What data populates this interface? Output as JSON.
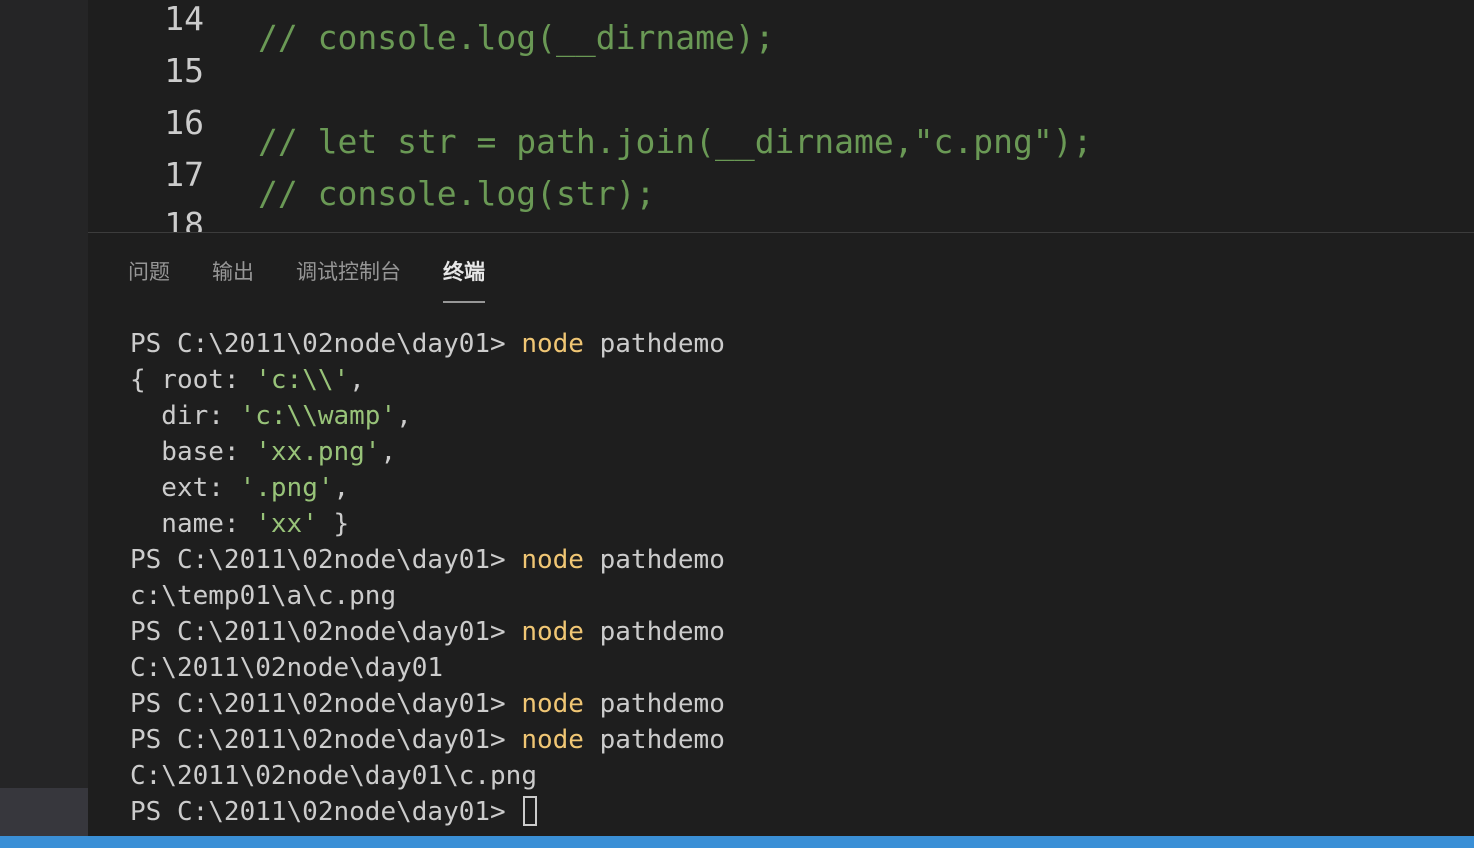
{
  "editor": {
    "lines": [
      {
        "num": "14",
        "code": "// console.log(__dirname);"
      },
      {
        "num": "15",
        "code": ""
      },
      {
        "num": "16",
        "code": "// let str = path.join(__dirname,\"c.png\");"
      },
      {
        "num": "17",
        "code": "// console.log(str);"
      },
      {
        "num": "18",
        "code": ""
      }
    ]
  },
  "panel": {
    "tabs": [
      {
        "label": "问题",
        "active": false
      },
      {
        "label": "输出",
        "active": false
      },
      {
        "label": "调试控制台",
        "active": false
      },
      {
        "label": "终端",
        "active": true
      }
    ]
  },
  "terminal": {
    "prompt": "PS C:\\2011\\02node\\day01> ",
    "cmd_keyword": "node",
    "cmd_arg": " pathdemo",
    "obj": {
      "l1_key": "{ root: ",
      "l1_val": "'c:\\\\'",
      "l1_end": ",",
      "l2_key": "  dir: ",
      "l2_val": "'c:\\\\wamp'",
      "l2_end": ",",
      "l3_key": "  base: ",
      "l3_val": "'xx.png'",
      "l3_end": ",",
      "l4_key": "  ext: ",
      "l4_val": "'.png'",
      "l4_end": ",",
      "l5_key": "  name: ",
      "l5_val": "'xx'",
      "l5_end": " }"
    },
    "out1": "c:\\temp01\\a\\c.png",
    "out2": "C:\\2011\\02node\\day01",
    "out3": "C:\\2011\\02node\\day01\\c.png"
  },
  "colors": {
    "background": "#1e1e1e",
    "comment": "#6a9955",
    "command": "#f0c674",
    "string": "#98c379",
    "status_bar": "#3a8fd6"
  }
}
